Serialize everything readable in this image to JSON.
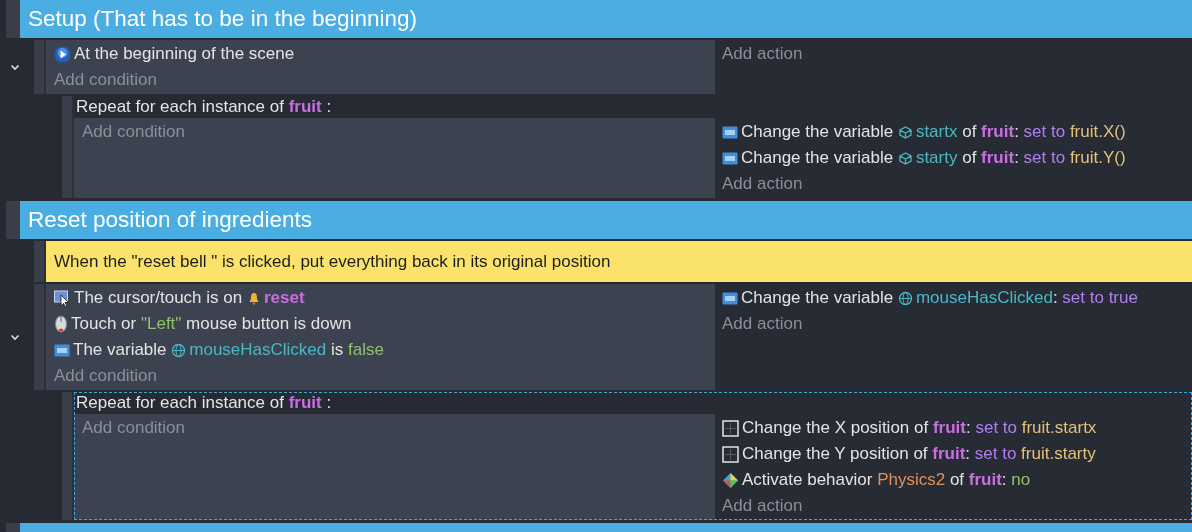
{
  "groups": [
    {
      "title": "Setup (That has to be in the beginning)",
      "events": [
        {
          "kind": "standard",
          "expanded": true,
          "conditions": [
            {
              "kind": "scene_start",
              "parts": [
                {
                  "text": "At the beginning of the scene"
                }
              ]
            }
          ],
          "add_condition": "Add condition",
          "add_action": "Add action",
          "children": [
            {
              "kind": "repeat",
              "selected": false,
              "header": [
                {
                  "text": "Repeat for each instance of "
                },
                {
                  "text": "fruit",
                  "kind": "object"
                },
                {
                  "text": " :"
                }
              ],
              "add_condition": "Add condition",
              "actions": [
                {
                  "kind": "variable",
                  "parts": [
                    {
                      "text": "Change the variable "
                    },
                    {
                      "text": "startx",
                      "kind": "object_variable"
                    },
                    {
                      "text": " of "
                    },
                    {
                      "text": "fruit",
                      "kind": "object"
                    },
                    {
                      "text": ": "
                    },
                    {
                      "text": "set to",
                      "kind": "operator"
                    },
                    {
                      "text": " fruit.X()",
                      "kind": "expression"
                    }
                  ]
                },
                {
                  "kind": "variable",
                  "parts": [
                    {
                      "text": "Change the variable "
                    },
                    {
                      "text": "starty",
                      "kind": "object_variable"
                    },
                    {
                      "text": " of "
                    },
                    {
                      "text": "fruit",
                      "kind": "object"
                    },
                    {
                      "text": ": "
                    },
                    {
                      "text": "set to",
                      "kind": "operator"
                    },
                    {
                      "text": " fruit.Y()",
                      "kind": "expression"
                    }
                  ]
                }
              ],
              "add_action": "Add action"
            }
          ]
        }
      ]
    },
    {
      "title": "Reset position of ingredients",
      "events": [
        {
          "kind": "comment",
          "text": "When the \"reset bell \" is clicked, put everything back in its original position"
        },
        {
          "kind": "standard",
          "expanded": true,
          "conditions": [
            {
              "kind": "cursor",
              "parts": [
                {
                  "text": "The cursor/touch is on "
                },
                {
                  "text": "reset",
                  "kind": "object_icon"
                }
              ]
            },
            {
              "kind": "mouse_button",
              "parts": [
                {
                  "text": "Touch or "
                },
                {
                  "text": "\"Left\"",
                  "kind": "string"
                },
                {
                  "text": " mouse button is down"
                }
              ]
            },
            {
              "kind": "variable",
              "parts": [
                {
                  "text": "The variable "
                },
                {
                  "text": "mouseHasClicked",
                  "kind": "global_variable"
                },
                {
                  "text": " is "
                },
                {
                  "text": "false",
                  "kind": "value"
                }
              ]
            }
          ],
          "add_condition": "Add condition",
          "actions": [
            {
              "kind": "variable",
              "parts": [
                {
                  "text": "Change the variable "
                },
                {
                  "text": "mouseHasClicked",
                  "kind": "global_variable"
                },
                {
                  "text": ": "
                },
                {
                  "text": "set to true",
                  "kind": "operator"
                }
              ]
            }
          ],
          "add_action": "Add action",
          "children": [
            {
              "kind": "repeat",
              "selected": true,
              "header": [
                {
                  "text": "Repeat for each instance of "
                },
                {
                  "text": "fruit",
                  "kind": "object"
                },
                {
                  "text": " :"
                }
              ],
              "add_condition": "Add condition",
              "actions": [
                {
                  "kind": "position",
                  "parts": [
                    {
                      "text": "Change the X position of "
                    },
                    {
                      "text": "fruit",
                      "kind": "object"
                    },
                    {
                      "text": ": "
                    },
                    {
                      "text": "set to",
                      "kind": "operator"
                    },
                    {
                      "text": " fruit.startx",
                      "kind": "expression"
                    }
                  ]
                },
                {
                  "kind": "position",
                  "parts": [
                    {
                      "text": "Change the Y position of "
                    },
                    {
                      "text": "fruit",
                      "kind": "object"
                    },
                    {
                      "text": ": "
                    },
                    {
                      "text": "set to",
                      "kind": "operator"
                    },
                    {
                      "text": " fruit.starty",
                      "kind": "expression"
                    }
                  ]
                },
                {
                  "kind": "behavior",
                  "parts": [
                    {
                      "text": "Activate behavior "
                    },
                    {
                      "text": "Physics2",
                      "kind": "behavior"
                    },
                    {
                      "text": " of "
                    },
                    {
                      "text": "fruit",
                      "kind": "object"
                    },
                    {
                      "text": ": "
                    },
                    {
                      "text": "no",
                      "kind": "value"
                    }
                  ]
                }
              ],
              "add_action": "Add action"
            }
          ]
        }
      ]
    }
  ]
}
